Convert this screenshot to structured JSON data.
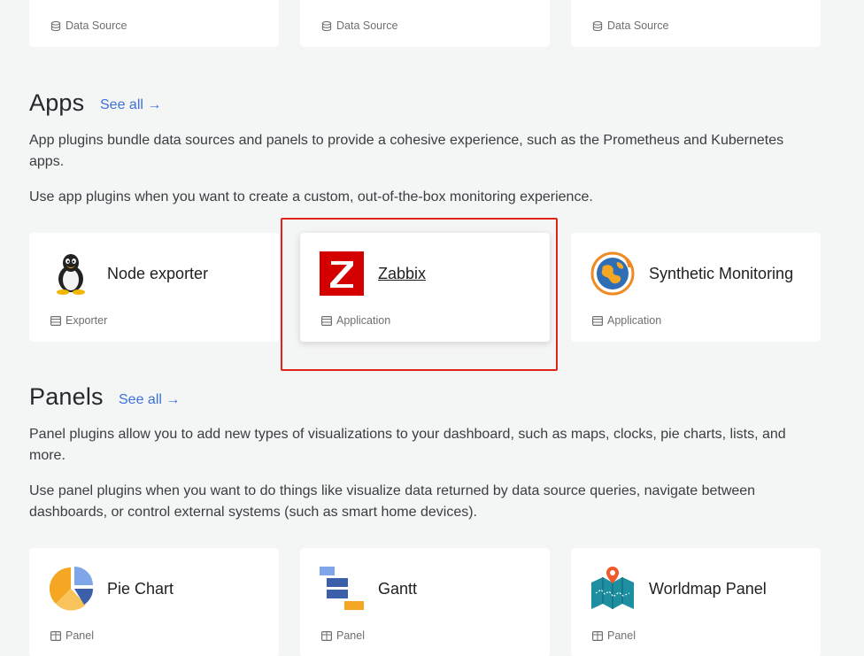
{
  "top_row": [
    {
      "type": "Data Source"
    },
    {
      "type": "Data Source"
    },
    {
      "type": "Data Source"
    }
  ],
  "apps": {
    "heading": "Apps",
    "see_all": "See all →",
    "description_1": "App plugins bundle data sources and panels to provide a cohesive experience, such as the Prometheus and Kubernetes apps.",
    "description_2": "Use app plugins when you want to create a custom, out-of-the-box monitoring experience.",
    "cards": [
      {
        "name": "Node exporter",
        "type": "Exporter",
        "icon": "linux-tux-icon"
      },
      {
        "name": "Zabbix",
        "type": "Application",
        "icon": "zabbix-logo-icon"
      },
      {
        "name": "Synthetic Monitoring",
        "type": "Application",
        "icon": "globe-icon"
      }
    ]
  },
  "panels": {
    "heading": "Panels",
    "see_all": "See all →",
    "description_1": "Panel plugins allow you to add new types of visualizations to your dashboard, such as maps, clocks, pie charts, lists, and more.",
    "description_2": "Use panel plugins when you want to do things like visualize data returned by data source queries, navigate between dashboards, or control external systems (such as smart home devices).",
    "cards": [
      {
        "name": "Pie Chart",
        "type": "Panel",
        "icon": "pie-chart-icon"
      },
      {
        "name": "Gantt",
        "type": "Panel",
        "icon": "gantt-icon"
      },
      {
        "name": "Worldmap Panel",
        "type": "Panel",
        "icon": "worldmap-icon"
      }
    ]
  },
  "colors": {
    "accent_link": "#3d71d9",
    "highlight_border": "#e2231a",
    "zabbix_red": "#d40000",
    "background": "#f4f5f5"
  }
}
